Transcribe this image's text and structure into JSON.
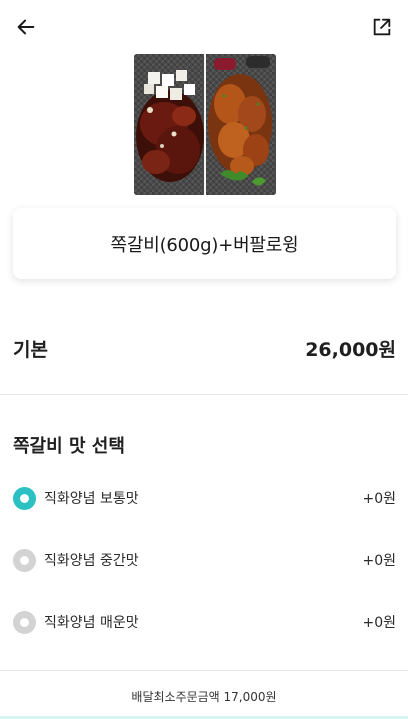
{
  "header": {
    "back_icon": "arrow-left-icon",
    "share_icon": "external-share-icon"
  },
  "product": {
    "image_description": "product-photo",
    "name": "쪽갈비(600g)+버팔로윙"
  },
  "base": {
    "label": "기본",
    "price": "26,000원"
  },
  "option_group": {
    "title": "쪽갈비 맛 선택",
    "options": [
      {
        "label": "직화양념 보통맛",
        "price": "+0원",
        "selected": true
      },
      {
        "label": "직화양념 중간맛",
        "price": "+0원",
        "selected": false
      },
      {
        "label": "직화양념 매운맛",
        "price": "+0원",
        "selected": false
      }
    ]
  },
  "footer": {
    "min_order": "배달최소주문금액 17,000원"
  },
  "colors": {
    "accent": "#2bc0c2",
    "radio_off": "#d3d3d3"
  }
}
